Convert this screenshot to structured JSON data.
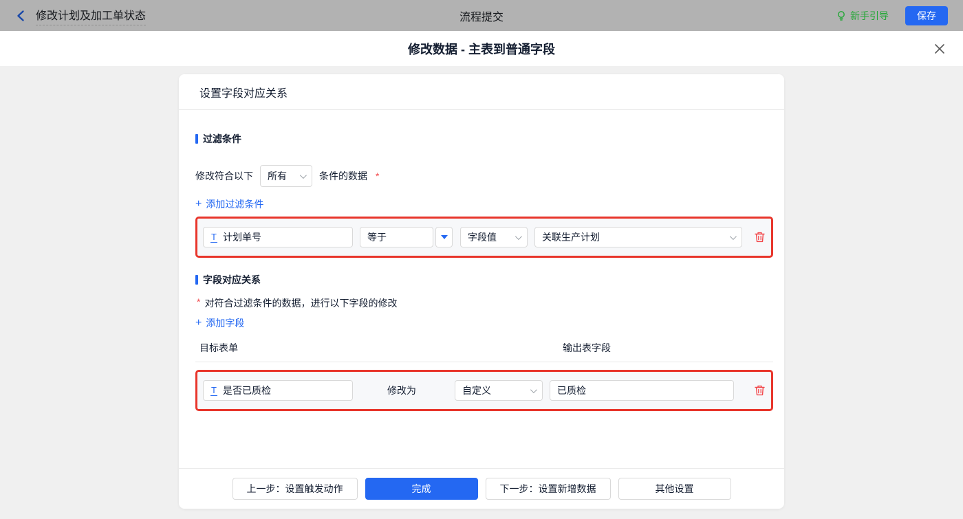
{
  "colors": {
    "accent": "#2468f2",
    "success_green": "#22a735",
    "danger_red": "#f2484b",
    "highlight_red": "#e8352b"
  },
  "topbar": {
    "title": "修改计划及加工单状态",
    "center_title": "流程提交",
    "guide_label": "新手引导",
    "save_label": "保存"
  },
  "modal": {
    "title": "修改数据 - 主表到普通字段"
  },
  "card": {
    "header": "设置字段对应关系",
    "filter": {
      "title": "过滤条件",
      "match_prefix": "修改符合以下",
      "match_select_value": "所有",
      "match_suffix": "条件的数据",
      "required_mark": "*",
      "add_plus": "+",
      "add_label": "添加过滤条件",
      "row": {
        "field_icon_glyph": "T",
        "field": "计划单号",
        "operator": "等于",
        "value_type": "字段值",
        "value": "关联生产计划"
      }
    },
    "mapping": {
      "title": "字段对应关系",
      "required_mark": "*",
      "description": "对符合过滤条件的数据，进行以下字段的修改",
      "add_plus": "+",
      "add_label": "添加字段",
      "col_target": "目标表单",
      "col_output": "输出表字段",
      "row": {
        "field_icon_glyph": "T",
        "field": "是否已质检",
        "modify_label": "修改为",
        "mode": "自定义",
        "value": "已质检"
      }
    },
    "footer": {
      "prev_label": "上一步：设置触发动作",
      "done_label": "完成",
      "next_label": "下一步：设置新增数据",
      "other_label": "其他设置"
    }
  }
}
